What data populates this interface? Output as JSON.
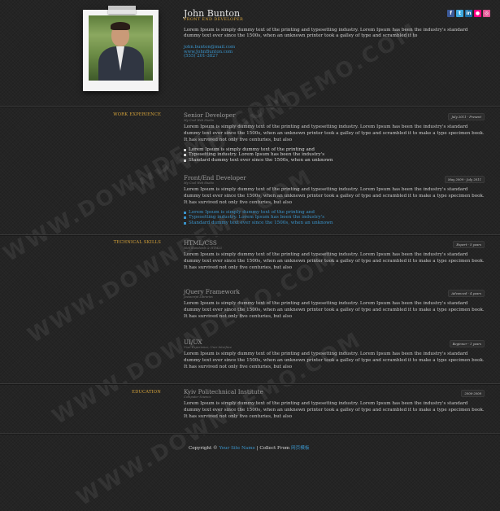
{
  "profile": {
    "name": "John Bunton",
    "role": "FRONT END DEVELOPER",
    "intro": "Lorem Ipsum is simply dummy text of the printing and typesetting industry. Lorem Ipsum has been the industry's standard dummy text ever since the 1500s, when an unknown printer took a galley of type and scrambled it to",
    "email": "john.bunton@mail.com",
    "website": "www.JohnBunton.com",
    "phone": "(555) 201-3827"
  },
  "social": [
    {
      "name": "facebook-icon",
      "glyph": "f",
      "color": "#3b5998"
    },
    {
      "name": "twitter-icon",
      "glyph": "t",
      "color": "#3fa9de"
    },
    {
      "name": "linkedin-icon",
      "glyph": "in",
      "color": "#1b6fa6"
    },
    {
      "name": "flickr-icon",
      "glyph": "●",
      "color": "#ff0084"
    },
    {
      "name": "dribbble-icon",
      "glyph": "◎",
      "color": "#e25594"
    }
  ],
  "sections": {
    "work": "WORK EXPERIENCE",
    "skills": "TECHNICAL SKILLS",
    "education": "EDUCATION"
  },
  "work": [
    {
      "title": "Senior Developer",
      "sub": "My Cool Web Studio",
      "date": "July 2011 - Present",
      "desc": "Lorem Ipsum is simply dummy text of the printing and typesetting industry. Lorem Ipsum has been the industry's standard dummy text ever since the 1500s, when an unknown printer took a galley of type and scrambled it to make a type specimen book. It has survived not only five centuries, but also",
      "bullets": [
        "Lorem Ipsum is simply dummy text of the printing and",
        "Typesetting industry. Lorem Ipsum has been the industry's",
        "Standard dummy text ever since the 1500s, when an unknown"
      ]
    },
    {
      "title": "Front/End Developer",
      "sub": "My Cool Web Studio",
      "date": "May 2009 - July 2011",
      "desc": "Lorem Ipsum is simply dummy text of the printing and typesetting industry. Lorem Ipsum has been the industry's standard dummy text ever since the 1500s, when an unknown printer took a galley of type and scrambled it to make a type specimen book. It has survived not only five centuries, but also",
      "bullets": [
        "Lorem Ipsum is simply dummy text of the printing and",
        "Typesetting industry. Lorem Ipsum has been the industry's",
        "Standard dummy text ever since the 1500s, when an unknown"
      ]
    }
  ],
  "skills": [
    {
      "title": "HTML/CSS",
      "sub": "Web Standards & HTML5",
      "date": "Expert - 5 years",
      "desc": "Lorem Ipsum is simply dummy text of the printing and typesetting industry. Lorem Ipsum has been the industry's standard dummy text ever since the 1500s, when an unknown printer took a galley of type and scrambled it to make a type specimen book. It has survived not only five centuries, but also"
    },
    {
      "title": "jQuery Framework",
      "sub": "Javascript Libraries",
      "date": "Advanced - 4 years",
      "desc": "Lorem Ipsum is simply dummy text of the printing and typesetting industry. Lorem Ipsum has been the industry's standard dummy text ever since the 1500s, when an unknown printer took a galley of type and scrambled it to make a type specimen book. It has survived not only five centuries, but also"
    },
    {
      "title": "UI/UX",
      "sub": "User Experience, User Interface",
      "date": "Beginner - 1 years",
      "desc": "Lorem Ipsum is simply dummy text of the printing and typesetting industry. Lorem Ipsum has been the industry's standard dummy text ever since the 1500s, when an unknown printer took a galley of type and scrambled it to make a type specimen book. It has survived not only five centuries, but also"
    }
  ],
  "education": [
    {
      "title": "Kyiv Politechnical Institute",
      "sub": "Computer Science",
      "date": "2006-2008",
      "desc": "Lorem Ipsum is simply dummy text of the printing and typesetting industry. Lorem Ipsum has been the industry's standard dummy text ever since the 1500s, when an unknown printer took a galley of type and scrambled it to make a type specimen book. It has survived not only five centuries, but also"
    }
  ],
  "footer": {
    "prefix": "Copyright ©",
    "site": "Your Site Name",
    "mid": "| Collect From",
    "link": "网页模板"
  },
  "watermark": "WWW.DOWNDEMO.COM"
}
